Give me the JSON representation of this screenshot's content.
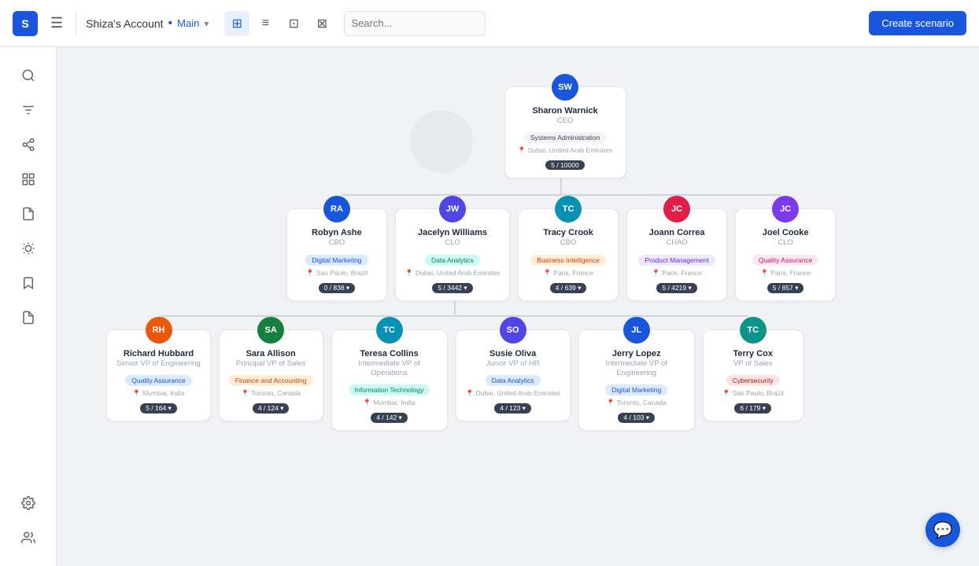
{
  "header": {
    "logo_text": "S",
    "account_name": "Shiza's Account",
    "branch_label": "Main",
    "toolbar_buttons": [
      {
        "id": "hierarchy",
        "icon": "⊞",
        "active": true
      },
      {
        "id": "list",
        "icon": "≡",
        "active": false
      },
      {
        "id": "compare",
        "icon": "⊡",
        "active": false
      },
      {
        "id": "chart",
        "icon": "⊠",
        "active": false
      }
    ],
    "search_placeholder": "Search...",
    "create_btn": "Create scenario"
  },
  "sidebar": {
    "items": [
      {
        "id": "search",
        "icon": "search",
        "active": false
      },
      {
        "id": "filter",
        "icon": "filter",
        "active": false
      },
      {
        "id": "network",
        "icon": "network",
        "active": false
      },
      {
        "id": "structure",
        "icon": "structure",
        "active": false
      },
      {
        "id": "document",
        "icon": "document",
        "active": false
      },
      {
        "id": "bulb",
        "icon": "bulb",
        "active": false
      },
      {
        "id": "bookmark",
        "icon": "bookmark",
        "active": false
      },
      {
        "id": "file",
        "icon": "file",
        "active": false
      },
      {
        "id": "settings",
        "icon": "settings",
        "active": false
      },
      {
        "id": "team",
        "icon": "team",
        "active": false
      }
    ]
  },
  "ceo": {
    "initials": "SW",
    "name": "Sharon Warnick",
    "title": "CEO",
    "badge": "Systems Administration",
    "badge_class": "badge-gray",
    "location": "Dubai, United Arab Emirates",
    "count": "5 / 10000",
    "av_class": "av-blue"
  },
  "ghost": true,
  "level1": [
    {
      "initials": "RA",
      "name": "Robyn Ashe",
      "title": "CBO",
      "badge": "Digital Marketing",
      "badge_class": "badge-blue",
      "location": "Sao Paulo, Brazil",
      "count": "0 / 838",
      "av_class": "av-blue"
    },
    {
      "initials": "JW",
      "name": "Jacelyn Williams",
      "title": "CLO",
      "badge": "Data Analytics",
      "badge_class": "badge-teal",
      "location": "Dubai, United Arab Emirates",
      "count": "5 / 3442",
      "av_class": "av-indigo"
    },
    {
      "initials": "TC",
      "name": "Tracy Crook",
      "title": "CBO",
      "badge": "Business Intelligence",
      "badge_class": "badge-orange",
      "location": "Paris, France",
      "count": "4 / 639",
      "av_class": "av-cyan"
    },
    {
      "initials": "JC",
      "name": "Joann Correa",
      "title": "CHAO",
      "badge": "Product Management",
      "badge_class": "badge-purple",
      "location": "Paris, France",
      "count": "5 / 4219",
      "av_class": "av-rose"
    },
    {
      "initials": "JC",
      "name": "Joel Cooke",
      "title": "CLO",
      "badge": "Quality Assurance",
      "badge_class": "badge-pink",
      "location": "Paris, France",
      "count": "5 / 857",
      "av_class": "av-violet"
    }
  ],
  "level2": [
    {
      "initials": "RH",
      "name": "Richard Hubbard",
      "title": "Senior VP of Engineering",
      "badge": "Quality Assurance",
      "badge_class": "badge-blue",
      "location": "Mumbai, India",
      "count": "5 / 164",
      "av_class": "av-orange"
    },
    {
      "initials": "SA",
      "name": "Sara Allison",
      "title": "Principal VP of Sales",
      "badge": "Finance and Accounting",
      "badge_class": "badge-orange",
      "location": "Toronto, Canada",
      "count": "4 / 124",
      "av_class": "av-green"
    },
    {
      "initials": "TC",
      "name": "Teresa Collins",
      "title": "Intermediate VP of Operations",
      "badge": "Information Technology",
      "badge_class": "badge-teal",
      "location": "Mumbai, India",
      "count": "4 / 142",
      "av_class": "av-cyan"
    },
    {
      "initials": "SO",
      "name": "Susie Oliva",
      "title": "Junior VP of HR",
      "badge": "Data Analytics",
      "badge_class": "badge-blue",
      "location": "Dubai, United Arab Emirates",
      "count": "4 / 123",
      "av_class": "av-indigo"
    },
    {
      "initials": "JL",
      "name": "Jerry Lopez",
      "title": "Intermediate VP of Engineering",
      "badge": "Digital Marketing",
      "badge_class": "badge-blue",
      "location": "Toronto, Canada",
      "count": "4 / 103",
      "av_class": "av-blue"
    },
    {
      "initials": "TC",
      "name": "Terry Cox",
      "title": "VP of Sales",
      "badge": "Cybersecurity",
      "badge_class": "badge-red",
      "location": "Sao Paulo, Brazil",
      "count": "6 / 179",
      "av_class": "av-teal"
    }
  ],
  "chat": {
    "icon": "💬"
  }
}
